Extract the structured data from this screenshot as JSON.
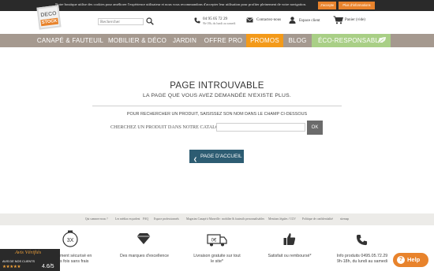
{
  "cookie_bar": {
    "text": "Notre boutique utilise des cookies pour améliorer l'expérience utilisateur et nous vous recommandons d'accepter leur utilisation pour profiter pleinement de votre navigation.",
    "accept_label": "J'accepte",
    "more_label": "Plus d'informations"
  },
  "header": {
    "logo_top": "DECO",
    "logo_bottom": "STOCK",
    "search_placeholder": "Rechercher",
    "phone_number": "04 95 05 72 29",
    "phone_hours": "9h-18h, du lundi au samedi",
    "contact_label": "Contactez-nous",
    "account_label": "Espace client",
    "cart_label": "Panier (vide)"
  },
  "nav": {
    "items": [
      {
        "label": "CANAPÉ & FAUTEUIL"
      },
      {
        "label": "MOBILIER & DÉCO"
      },
      {
        "label": "JARDIN"
      },
      {
        "label": "OFFRE PRO"
      },
      {
        "label": "PROMOS"
      },
      {
        "label": "BLOG"
      },
      {
        "label": "ÉCO-RESPONSABLE"
      }
    ]
  },
  "main": {
    "title": "PAGE INTROUVABLE",
    "subtitle": "LA PAGE QUE VOUS AVEZ DEMANDÉE N'EXISTE PLUS.",
    "search_hint": "POUR RECHERCHER UN PRODUIT, SAISISSEZ SON NOM DANS LE CHAMP CI-DESSOUS",
    "catalog_label": "CHERCHEZ UN PRODUIT DANS NOTRE CATALOGUE :",
    "catalog_value": "",
    "ok_label": "OK",
    "home_button_label": "PAGE D'ACCUEIL"
  },
  "footer": {
    "links": [
      "Qui sommes-nous ?",
      "Les médias en parlent",
      "FAQ",
      "Espace professionnels",
      "Magasins Canapé à Marseille : mobilier & fauteuils personnalisables",
      "Mentions légales / CGV",
      "Politique de confidentialité",
      "sitemap"
    ],
    "features": [
      {
        "icon": "secure-payment-3x-icon",
        "badge": "3X",
        "text_line1": "ement sécurisé en",
        "text_line2": "us fois sans frais"
      },
      {
        "icon": "quality-diamond-icon",
        "text_line1": "Des marques d'excellence",
        "text_line2": ""
      },
      {
        "icon": "free-delivery-truck-icon",
        "badge": "0€",
        "text_line1": "Livraison gratuite sur tout",
        "text_line2": "le site*"
      },
      {
        "icon": "satisfaction-thumb-icon",
        "text_line1": "Satisfait ou remboursé*",
        "text_line2": ""
      },
      {
        "icon": "phone-icon",
        "text_line1": "Info produits 0495.05.72.29",
        "text_line2": "9h-18h, du lundi au samedi"
      }
    ]
  },
  "review_badge": {
    "brand": "Avis Vérifiés",
    "caption": "AVIS DE NOS CLIENTS",
    "stars": "★★★★★",
    "score": "4.6/5"
  },
  "help": {
    "label": "Help",
    "icon": "?"
  },
  "colors": {
    "accent_orange": "#e8832c",
    "nav_bg": "#a5998f",
    "promos_bg": "#f39a1a",
    "eco_bg": "#a9cf86",
    "home_button_bg": "#2d5c72"
  }
}
